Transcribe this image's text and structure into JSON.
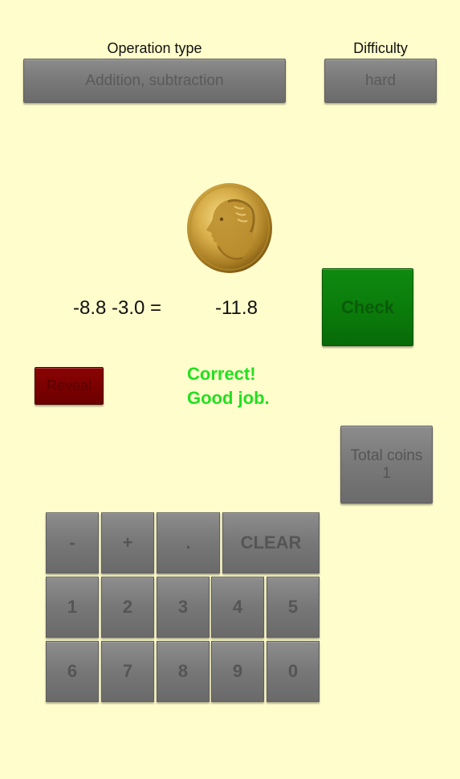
{
  "operation": {
    "label": "Operation type",
    "value": "Addition, subtraction"
  },
  "difficulty": {
    "label": "Difficulty",
    "value": "hard"
  },
  "problem": {
    "equation": "-8.8 -3.0 =",
    "answer": "-11.8"
  },
  "check_label": "Check",
  "reveal_label": "Reveal",
  "feedback": {
    "line1": "Correct!",
    "line2": "Good job."
  },
  "coins": {
    "label": "Total coins",
    "count": "1"
  },
  "keypad": {
    "minus": "-",
    "plus": "+",
    "dot": ".",
    "clear": "CLEAR",
    "k1": "1",
    "k2": "2",
    "k3": "3",
    "k4": "4",
    "k5": "5",
    "k6": "6",
    "k7": "7",
    "k8": "8",
    "k9": "9",
    "k0": "0"
  },
  "colors": {
    "background": "#FFFDCC",
    "check": "#0A7A0A",
    "reveal": "#790000",
    "feedback": "#22E01E",
    "coin": "#C9A033"
  },
  "icons": {
    "coin": "gold-coin-icon"
  }
}
